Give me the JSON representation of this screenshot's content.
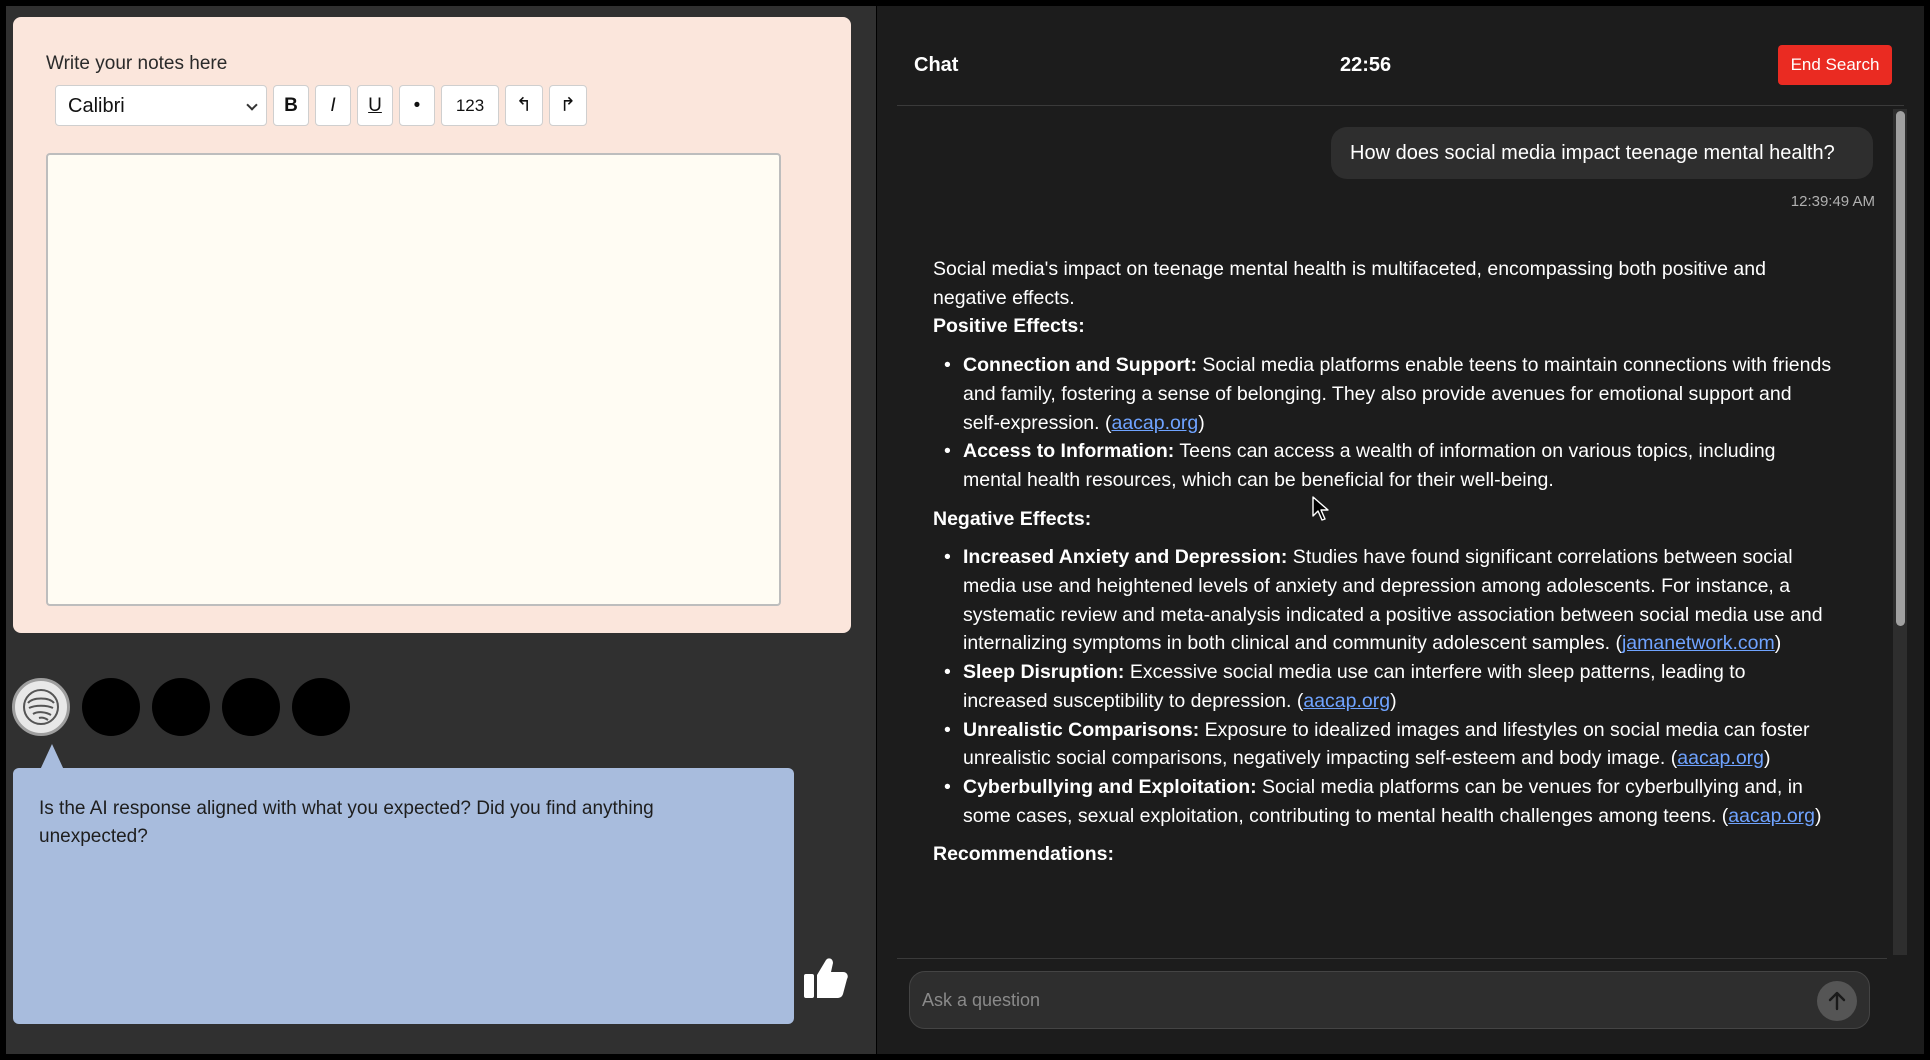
{
  "notes": {
    "label": "Write your notes here",
    "font_value": "Calibri",
    "bold_label": "B",
    "italic_label": "I",
    "underline_label": "U",
    "bullet_label": "•",
    "numbered_label": "123",
    "outdent_label": "↰",
    "indent_label": "↱",
    "editor_value": ""
  },
  "prompt": {
    "text": "Is the AI response aligned with what you expected? Did you find anything unexpected?"
  },
  "chat": {
    "title": "Chat",
    "timer": "22:56",
    "end_button": "End Search",
    "user_message": "How does social media impact teenage mental health?",
    "user_message_time": "12:39:49 AM",
    "answer": {
      "intro": "Social media's impact on teenage mental health is multifaceted, encompassing both positive and negative effects.",
      "positive_heading": "Positive Effects:",
      "positive": [
        {
          "title": "Connection and Support:",
          "text": " Social media platforms enable teens to maintain connections with friends and family, fostering a sense of belonging. They also provide avenues for emotional support and self-expression. (",
          "link": "aacap.org",
          "after": ")"
        },
        {
          "title": "Access to Information:",
          "text": " Teens can access a wealth of information on various topics, including mental health resources, which can be beneficial for their well-being.",
          "link": "",
          "after": ""
        }
      ],
      "negative_heading": "Negative Effects:",
      "negative": [
        {
          "title": "Increased Anxiety and Depression:",
          "text": " Studies have found significant correlations between social media use and heightened levels of anxiety and depression among adolescents. For instance, a systematic review and meta-analysis indicated a positive association between social media use and internalizing symptoms in both clinical and community adolescent samples. (",
          "link": "jamanetwork.com",
          "after": ")"
        },
        {
          "title": "Sleep Disruption:",
          "text": " Excessive social media use can interfere with sleep patterns, leading to increased susceptibility to depression. (",
          "link": "aacap.org",
          "after": ")"
        },
        {
          "title": "Unrealistic Comparisons:",
          "text": " Exposure to idealized images and lifestyles on social media can foster unrealistic social comparisons, negatively impacting self-esteem and body image. (",
          "link": "aacap.org",
          "after": ")"
        },
        {
          "title": "Cyberbullying and Exploitation:",
          "text": " Social media platforms can be venues for cyberbullying and, in some cases, sexual exploitation, contributing to mental health challenges among teens. (",
          "link": "aacap.org",
          "after": ")"
        }
      ],
      "recommendations_heading": "Recommendations:"
    },
    "input_placeholder": "Ask a question",
    "input_value": ""
  },
  "icons": {
    "assistant": "assistant-face-icon",
    "thumbs": "thumbs-up-icon",
    "send": "arrow-up-icon",
    "cursor": "mouse-pointer-icon"
  },
  "colors": {
    "notes_bg": "#fbe6dc",
    "prompt_bg": "#a8bcdd",
    "end_button": "#ea2b22",
    "link": "#6fa3ff"
  }
}
